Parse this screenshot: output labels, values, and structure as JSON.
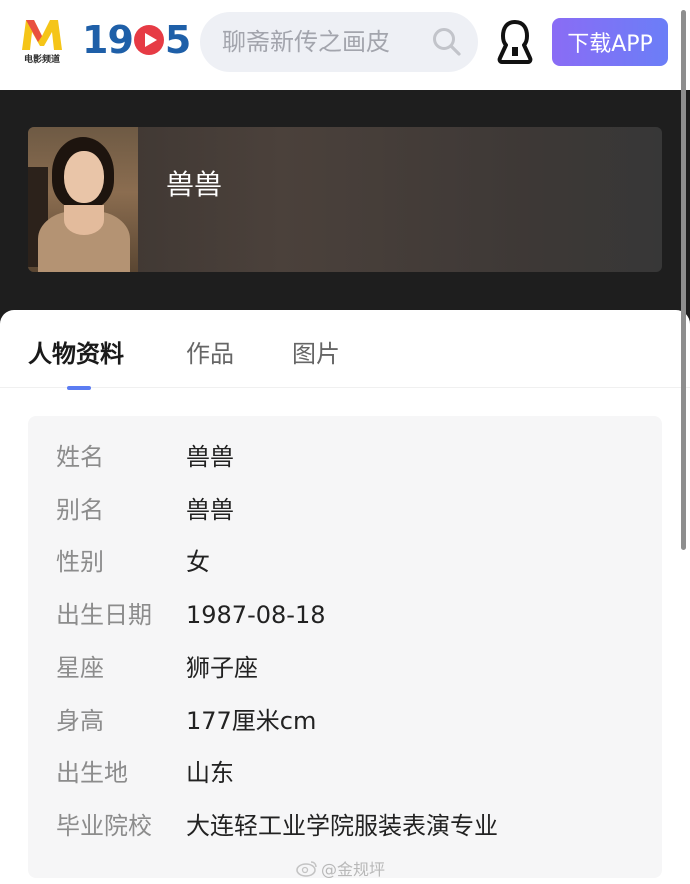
{
  "header": {
    "logo_sub": "电影频道",
    "logo_text_left": "19",
    "logo_text_right": "5",
    "search_placeholder": "聊斋新传之画皮",
    "download_label": "下载APP"
  },
  "profile": {
    "name": "兽兽"
  },
  "tabs": [
    {
      "label": "人物资料",
      "active": true
    },
    {
      "label": "作品",
      "active": false
    },
    {
      "label": "图片",
      "active": false
    }
  ],
  "info": [
    {
      "label": "姓名",
      "value": "兽兽"
    },
    {
      "label": "别名",
      "value": "兽兽"
    },
    {
      "label": "性别",
      "value": "女"
    },
    {
      "label": "出生日期",
      "value": "1987-08-18"
    },
    {
      "label": "星座",
      "value": "狮子座"
    },
    {
      "label": "身高",
      "value": "177厘米cm"
    },
    {
      "label": "出生地",
      "value": "山东"
    },
    {
      "label": "毕业院校",
      "value": "大连轻工业学院服装表演专业"
    }
  ],
  "watermark": "@金规坪",
  "colors": {
    "accent": "#5b7cf2",
    "brand_blue": "#1e5fa8",
    "brand_red": "#e63b45",
    "brand_yellow": "#f5c518"
  }
}
